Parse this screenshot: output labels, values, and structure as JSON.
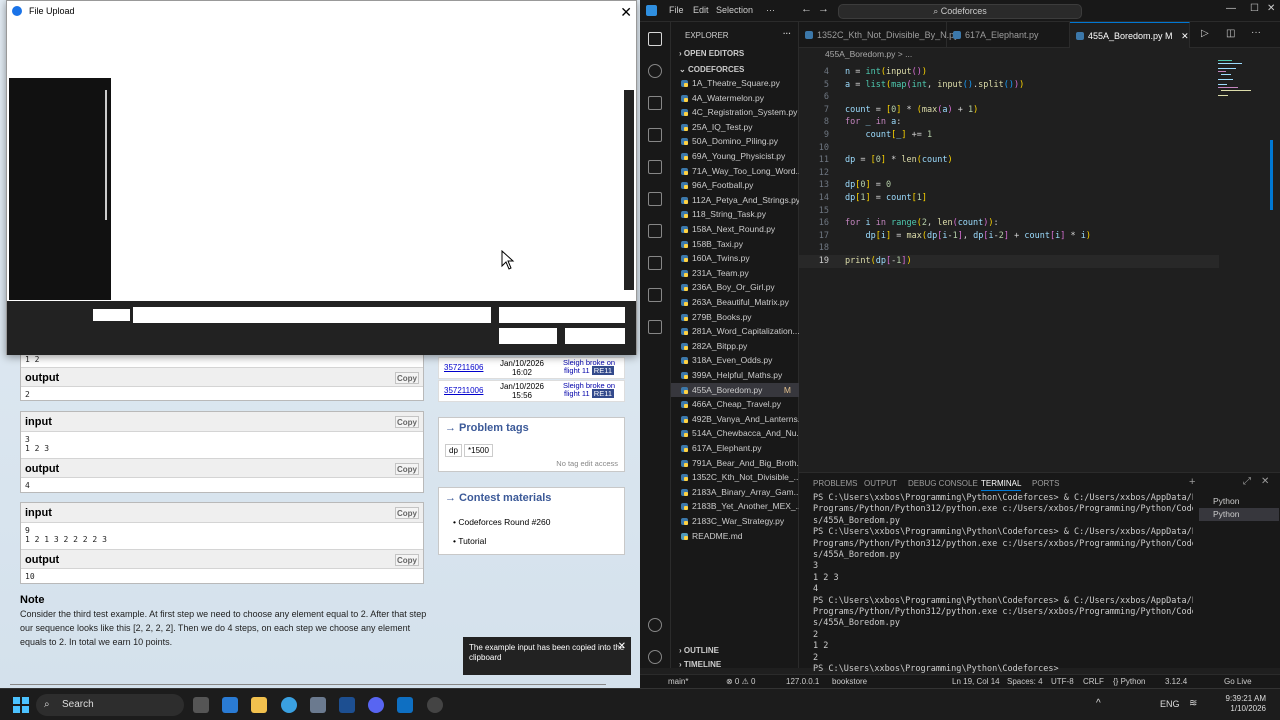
{
  "browser": {
    "samples": [
      {
        "input": "1 2",
        "output": "2"
      },
      {
        "input": "3\n1 2 3",
        "output": "4"
      },
      {
        "input": "9\n1 2 1 3 2 2 2 2 3",
        "output": "10"
      }
    ],
    "labels": {
      "input": "input",
      "output": "output",
      "copy": "Copy"
    },
    "note_title": "Note",
    "note_text": "Consider the third test example. At first step we need to choose any element equal to 2. After that step our sequence looks like this [2, 2, 2, 2]. Then we do 4 steps, on each step we choose any element equals to 2. In total we earn 10 points.",
    "submissions": [
      {
        "id": "357211606",
        "date": "Jan/10/2026",
        "time": "16:02",
        "verdict": "Sleigh broke on flight 11",
        "badge": "RE11"
      },
      {
        "id": "357211006",
        "date": "Jan/10/2026",
        "time": "15:56",
        "verdict": "Sleigh broke on flight 11",
        "badge": "RE11"
      }
    ],
    "problem_tags": {
      "title": "→ Problem tags",
      "tags": [
        "dp",
        "*1500"
      ],
      "footer": "No tag edit access"
    },
    "contest_materials": {
      "title": "→ Contest materials",
      "items": [
        "Codeforces Round #260",
        "Tutorial"
      ]
    },
    "toast": "The example input has been copied into the clipboard",
    "dialog_title": "File Upload"
  },
  "vscode": {
    "menu": [
      "File",
      "Edit",
      "Selection"
    ],
    "search": "Codeforces",
    "explorer_title": "EXPLORER",
    "open_editors": "OPEN EDITORS",
    "folder": "CODEFORCES",
    "files": [
      "1A_Theatre_Square.py",
      "4A_Watermelon.py",
      "4C_Registration_System.py",
      "25A_IQ_Test.py",
      "50A_Domino_Piling.py",
      "69A_Young_Physicist.py",
      "71A_Way_Too_Long_Word...",
      "96A_Football.py",
      "112A_Petya_And_Strings.py",
      "118_String_Task.py",
      "158A_Next_Round.py",
      "158B_Taxi.py",
      "160A_Twins.py",
      "231A_Team.py",
      "236A_Boy_Or_Girl.py",
      "263A_Beautiful_Matrix.py",
      "279B_Books.py",
      "281A_Word_Capitalization...",
      "282A_Bitpp.py",
      "318A_Even_Odds.py",
      "399A_Helpful_Maths.py",
      "455A_Boredom.py",
      "466A_Cheap_Travel.py",
      "492B_Vanya_And_Lanterns...",
      "514A_Chewbacca_And_Nu...",
      "617A_Elephant.py",
      "791A_Bear_And_Big_Broth...",
      "1352C_Kth_Not_Divisible_...",
      "2183A_Binary_Array_Gam...",
      "2183B_Yet_Another_MEX_...",
      "2183C_War_Strategy.py",
      "README.md"
    ],
    "selected_file": "455A_Boredom.py",
    "modified_mark": "M",
    "outline": "OUTLINE",
    "timeline": "TIMELINE",
    "tabs": [
      "1352C_Kth_Not_Divisible_By_N.py",
      "617A_Elephant.py",
      "455A_Boredom.py M"
    ],
    "breadcrumb": "455A_Boredom.py > ...",
    "line_numbers": [
      "4",
      "5",
      "6",
      "7",
      "8",
      "9",
      "10",
      "11",
      "12",
      "13",
      "14",
      "15",
      "16",
      "17",
      "18",
      "19"
    ],
    "panel_tabs": [
      "PROBLEMS",
      "OUTPUT",
      "DEBUG CONSOLE",
      "TERMINAL",
      "PORTS"
    ],
    "terminal": [
      "PS C:\\Users\\xxbos\\Programming\\Python\\Codeforces> & C:/Users/xxbos/AppData/Local/",
      "Programs/Python/Python312/python.exe c:/Users/xxbos/Programming/Python/Codeforces/",
      "s/455A_Boredom.py",
      "PS C:\\Users\\xxbos\\Programming\\Python\\Codeforces> & C:/Users/xxbos/AppData/Local/",
      "Programs/Python/Python312/python.exe c:/Users/xxbos/Programming/Python/Codeforces/",
      "s/455A_Boredom.py",
      "3",
      "1 2 3",
      "4",
      "PS C:\\Users\\xxbos\\Programming\\Python\\Codeforces> & C:/Users/xxbos/AppData/Local/",
      "Programs/Python/Python312/python.exe c:/Users/xxbos/Programming/Python/Codeforces/",
      "s/455A_Boredom.py",
      "2",
      "1 2",
      "2",
      "PS C:\\Users\\xxbos\\Programming\\Python\\Codeforces> "
    ],
    "terminal_list": [
      "Python",
      "Python"
    ],
    "status_left": [
      "main*",
      "⊗ 0 ⚠ 0",
      "127.0.0.1",
      "bookstore"
    ],
    "status_right": [
      "Ln 19, Col 14",
      "Spaces: 4",
      "UTF-8",
      "CRLF",
      "{} Python",
      "3.12.4",
      "Go Live"
    ]
  },
  "taskbar": {
    "search": "Search",
    "lang": "ENG",
    "time": "9:39:21 AM",
    "date": "1/10/2026"
  }
}
